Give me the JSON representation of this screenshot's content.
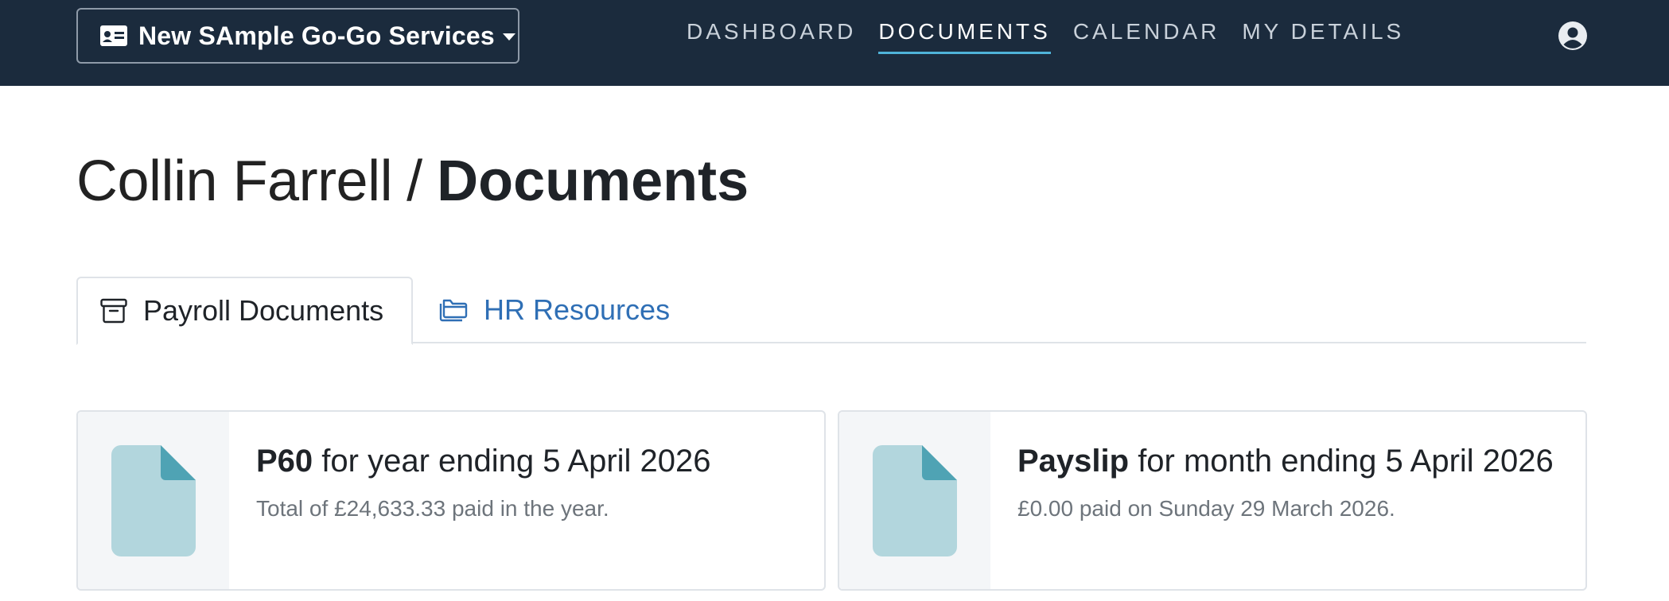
{
  "app": {
    "company_name": "New SAmple Go-Go Services",
    "colors": {
      "topbar": "#1b2b3d",
      "accent": "#4fb3d9",
      "link": "#2f6fb5",
      "doc_icon": "#b2d6dd",
      "doc_fold": "#4fa3b4"
    }
  },
  "nav": {
    "items": [
      {
        "label": "DASHBOARD"
      },
      {
        "label": "DOCUMENTS"
      },
      {
        "label": "CALENDAR"
      },
      {
        "label": "MY DETAILS"
      }
    ],
    "active": "DOCUMENTS"
  },
  "page": {
    "person": "Collin Farrell",
    "separator": "/",
    "section": "Documents"
  },
  "tabs": [
    {
      "label": "Payroll Documents",
      "icon": "archive-box-icon",
      "active": true
    },
    {
      "label": "HR Resources",
      "icon": "folders-icon",
      "active": false
    }
  ],
  "documents": [
    {
      "title_bold": "P60",
      "title_rest": " for year ending 5 April 2026",
      "description": "Total of £24,633.33 paid in the year.",
      "icon": "document-icon"
    },
    {
      "title_bold": "Payslip",
      "title_rest": " for month ending 5 April 2026",
      "description": "£0.00 paid on Sunday 29 March 2026.",
      "icon": "document-icon"
    }
  ]
}
